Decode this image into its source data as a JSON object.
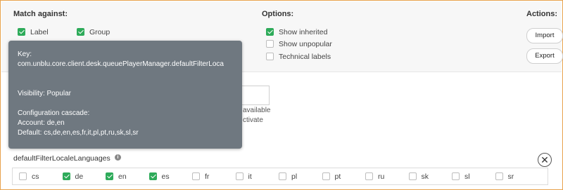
{
  "match_against": {
    "heading": "Match against:",
    "items": [
      {
        "label": "Label",
        "checked": true
      },
      {
        "label": "Group",
        "checked": true
      }
    ]
  },
  "options": {
    "heading": "Options:",
    "items": [
      {
        "label": "Show inherited",
        "checked": true
      },
      {
        "label": "Show unpopular",
        "checked": false
      },
      {
        "label": "Technical labels",
        "checked": false
      }
    ]
  },
  "actions": {
    "heading": "Actions:",
    "import_label": "Import",
    "export_label": "Export"
  },
  "partial_text": {
    "line1": "available",
    "line2": "ctivate"
  },
  "tooltip": {
    "key_label": "Key:",
    "key_value": "com.unblu.core.client.desk.queuePlayerManager.defaultFilterLoca",
    "visibility": "Visibility: Popular",
    "cascade_label": "Configuration cascade:",
    "account": "Account: de,en",
    "default": "Default: cs,de,en,es,fr,it,pl,pt,ru,sk,sl,sr"
  },
  "setting": {
    "name": "defaultFilterLocaleLanguages",
    "info_icon": "i",
    "close_icon": "✕",
    "languages": [
      {
        "code": "cs",
        "checked": false
      },
      {
        "code": "de",
        "checked": true
      },
      {
        "code": "en",
        "checked": true
      },
      {
        "code": "es",
        "checked": true
      },
      {
        "code": "fr",
        "checked": false
      },
      {
        "code": "it",
        "checked": false
      },
      {
        "code": "pl",
        "checked": false
      },
      {
        "code": "pt",
        "checked": false
      },
      {
        "code": "ru",
        "checked": false
      },
      {
        "code": "sk",
        "checked": false
      },
      {
        "code": "sl",
        "checked": false
      },
      {
        "code": "sr",
        "checked": false
      }
    ]
  }
}
